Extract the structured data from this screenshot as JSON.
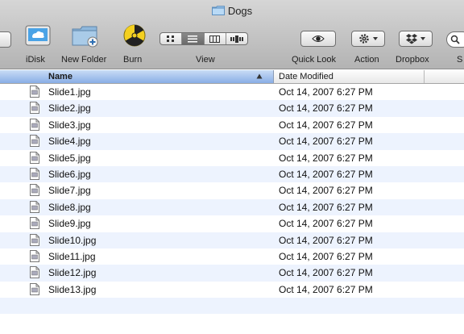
{
  "window": {
    "title": "Dogs"
  },
  "toolbar": {
    "idisk_label": "iDisk",
    "new_folder_label": "New Folder",
    "burn_label": "Burn",
    "view_label": "View",
    "quick_look_label": "Quick Look",
    "action_label": "Action",
    "dropbox_label": "Dropbox",
    "search_label_partial": "S"
  },
  "columns": {
    "name": "Name",
    "date_modified": "Date Modified"
  },
  "files": [
    {
      "name": "Slide1.jpg",
      "date": "Oct 14, 2007 6:27 PM"
    },
    {
      "name": "Slide2.jpg",
      "date": "Oct 14, 2007 6:27 PM"
    },
    {
      "name": "Slide3.jpg",
      "date": "Oct 14, 2007 6:27 PM"
    },
    {
      "name": "Slide4.jpg",
      "date": "Oct 14, 2007 6:27 PM"
    },
    {
      "name": "Slide5.jpg",
      "date": "Oct 14, 2007 6:27 PM"
    },
    {
      "name": "Slide6.jpg",
      "date": "Oct 14, 2007 6:27 PM"
    },
    {
      "name": "Slide7.jpg",
      "date": "Oct 14, 2007 6:27 PM"
    },
    {
      "name": "Slide8.jpg",
      "date": "Oct 14, 2007 6:27 PM"
    },
    {
      "name": "Slide9.jpg",
      "date": "Oct 14, 2007 6:27 PM"
    },
    {
      "name": "Slide10.jpg",
      "date": "Oct 14, 2007 6:27 PM"
    },
    {
      "name": "Slide11.jpg",
      "date": "Oct 14, 2007 6:27 PM"
    },
    {
      "name": "Slide12.jpg",
      "date": "Oct 14, 2007 6:27 PM"
    },
    {
      "name": "Slide13.jpg",
      "date": "Oct 14, 2007 6:27 PM"
    }
  ],
  "colors": {
    "stripe": "#edf3fe",
    "header_selected": "#89aee6"
  }
}
